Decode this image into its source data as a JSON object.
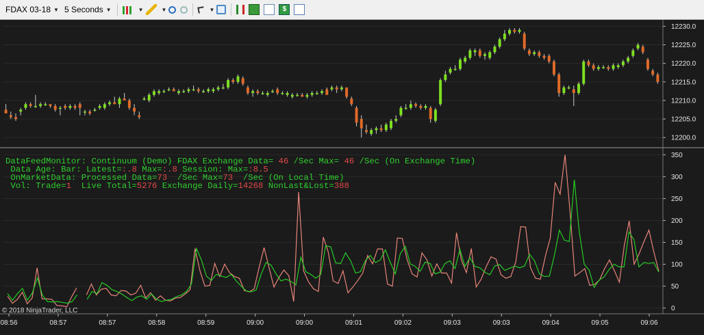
{
  "toolbar": {
    "instrument": "FDAX 03-18",
    "interval": "5 Seconds",
    "icons": [
      "candlestick-chart-icon",
      "pencil-draw-icon",
      "zoom-in-icon",
      "zoom-out-icon",
      "cursor-pointer-icon",
      "crosshair-icon",
      "bar-type-icon",
      "chart-tools-icon",
      "line-chart-icon",
      "dollar-trade-icon",
      "properties-icon"
    ]
  },
  "monitor": {
    "line1": {
      "a": "DataFeedMonitor: Continuum (Demo) FDAX Exchange Data= ",
      "b": "46",
      "c": " /Sec Max= ",
      "d": "46",
      "e": " /Sec (On Exchange Time)"
    },
    "line2": {
      "a": " Data Age: Bar: Latest=",
      "b": ":.8",
      "c": " Max=",
      "d": ":.8",
      "e": " Session: Max=",
      "f": ":8.5"
    },
    "line3": {
      "a": " OnMarketData: Processed Data=",
      "b": "73",
      "c": "  /Sec Max=",
      "d": "73",
      "e": "  /Sec (On Local Time)"
    },
    "line4": {
      "a": " Vol: Trade=",
      "b": "1",
      "c": "  Live Total=",
      "d": "5276",
      "e": " Exchange Daily=",
      "f": "14268",
      "g": " NonLast&Lost=",
      "h": "388"
    }
  },
  "copyright": "© 2018 NinjaTrader, LLC",
  "colors": {
    "up": "#7ee020",
    "down": "#e06a28",
    "green_line": "#26cc26",
    "red_line": "#e8857a",
    "grid": "#2a2a2a"
  },
  "chart_data": [
    {
      "type": "candlestick",
      "ylim": [
        12198,
        12231
      ],
      "yticks": [
        "12200.0",
        "12205.0",
        "12210.0",
        "12215.0",
        "12220.0",
        "12225.0",
        "12230.0"
      ],
      "xticks": [
        "08:56",
        "08:57",
        "08:57",
        "08:58",
        "08:59",
        "09:00",
        "09:00",
        "09:01",
        "09:02",
        "09:03",
        "09:03",
        "09:04",
        "09:05",
        "09:06"
      ],
      "bars": [
        [
          12207.5,
          12209,
          12207,
          12206.5
        ],
        [
          12206,
          12207,
          12205,
          12205.5
        ],
        [
          12205.5,
          12206.5,
          12204.5,
          12205
        ],
        [
          12207,
          12208,
          12206,
          12207.5
        ],
        [
          12208,
          12209.5,
          12207.5,
          12209
        ],
        [
          12209,
          12209.5,
          12208,
          12208.5
        ],
        [
          12208.5,
          12211.5,
          12208,
          12208.5
        ],
        [
          12208.5,
          12209.5,
          12208,
          12209
        ],
        [
          12209,
          12209.5,
          12208.5,
          12209
        ],
        [
          12209,
          12209,
          12208,
          12208.5
        ],
        [
          12208.5,
          12209,
          12207,
          12207.5
        ],
        [
          12208,
          12208.5,
          12206,
          12208
        ],
        [
          12208.5,
          12209,
          12207.5,
          12208
        ],
        [
          12208,
          12209,
          12207.5,
          12208.5
        ],
        [
          12208.5,
          12209,
          12207.5,
          12208
        ],
        [
          12209,
          12209.5,
          12206,
          12208
        ],
        [
          12207,
          12207.5,
          12206,
          12207
        ],
        [
          12207,
          12207.5,
          12206,
          12206.5
        ],
        [
          12207.5,
          12208,
          12207,
          12207.5
        ],
        [
          12208,
          12209,
          12207.5,
          12208.5
        ],
        [
          12208,
          12209.5,
          12207.5,
          12209
        ],
        [
          12209,
          12210,
          12208.5,
          12209.5
        ],
        [
          12209.5,
          12211,
          12209,
          12209
        ],
        [
          12209,
          12211,
          12208,
          12210.5
        ],
        [
          12210.5,
          12212,
          12210,
          12210
        ],
        [
          12210,
          12210.5,
          12207.5,
          12208
        ],
        [
          12208,
          12209,
          12206,
          12207
        ],
        [
          12206,
          12207,
          12205,
          12205.5
        ],
        [
          12210.5,
          12211,
          12210,
          12210.5
        ],
        [
          12210,
          12212,
          12209.5,
          12211.5
        ],
        [
          12211.5,
          12213,
          12211,
          12212.5
        ],
        [
          12212,
          12213,
          12211.5,
          12212.5
        ],
        [
          12212.5,
          12213,
          12212,
          12212.5
        ],
        [
          12213,
          12213.5,
          12212.5,
          12213
        ],
        [
          12213,
          12213.5,
          12212.5,
          12212.5
        ],
        [
          12212,
          12213,
          12211.5,
          12212.5
        ],
        [
          12212.5,
          12213,
          12212,
          12212.5
        ],
        [
          12212.5,
          12213.5,
          12212,
          12213
        ],
        [
          12213,
          12214,
          12212.5,
          12213
        ],
        [
          12213,
          12213.5,
          12212,
          12212.5
        ],
        [
          12212.5,
          12213,
          12212,
          12212.5
        ],
        [
          12212.5,
          12213.5,
          12212,
          12213
        ],
        [
          12212.5,
          12213.5,
          12212,
          12213
        ],
        [
          12213,
          12214,
          12212.5,
          12213.5
        ],
        [
          12213.5,
          12214.5,
          12213,
          12213.5
        ],
        [
          12213.5,
          12216,
          12213,
          12215.5
        ],
        [
          12215.5,
          12216,
          12214.5,
          12215
        ],
        [
          12215,
          12217,
          12214.5,
          12216.5
        ],
        [
          12216,
          12216.5,
          12214,
          12214.5
        ],
        [
          12213.5,
          12214,
          12211.5,
          12212
        ],
        [
          12212,
          12213,
          12211,
          12212.5
        ],
        [
          12212.5,
          12213,
          12211.5,
          12212
        ],
        [
          12212,
          12212.5,
          12211.5,
          12212
        ],
        [
          12211.5,
          12212.5,
          12211,
          12212
        ],
        [
          12212.5,
          12213,
          12212,
          12212.5
        ],
        [
          12213,
          12213.5,
          12211.5,
          12212
        ],
        [
          12212,
          12212.5,
          12211.5,
          12212
        ],
        [
          12211.5,
          12212.5,
          12211,
          12212
        ],
        [
          12211,
          12212,
          12210.5,
          12211.5
        ],
        [
          12211.5,
          12212,
          12211,
          12211.5
        ],
        [
          12211.5,
          12212,
          12211,
          12211
        ],
        [
          12211,
          12212,
          12210.5,
          12211.5
        ],
        [
          12211.5,
          12212.5,
          12211,
          12212
        ],
        [
          12212,
          12212.5,
          12211.5,
          12212
        ],
        [
          12212,
          12213,
          12211.5,
          12212.5
        ],
        [
          12213,
          12213.5,
          12211.5,
          12211.5
        ],
        [
          12213,
          12214,
          12212.5,
          12213.5
        ],
        [
          12213.5,
          12214,
          12212,
          12213
        ],
        [
          12213,
          12214,
          12212.5,
          12213.5
        ],
        [
          12213.5,
          12213.5,
          12210.5,
          12211
        ],
        [
          12210.5,
          12211,
          12208.5,
          12209
        ],
        [
          12208,
          12208.5,
          12203,
          12204
        ],
        [
          12205,
          12206,
          12200,
          12202.5
        ],
        [
          12202,
          12203.5,
          12201,
          12201.5
        ],
        [
          12201,
          12202.5,
          12200.5,
          12202
        ],
        [
          12202,
          12203,
          12201,
          12202.5
        ],
        [
          12202.5,
          12203.5,
          12201.5,
          12202
        ],
        [
          12202,
          12204,
          12201.5,
          12203.5
        ],
        [
          12202.5,
          12205,
          12202,
          12204.5
        ],
        [
          12204.5,
          12206,
          12204,
          12205
        ],
        [
          12206,
          12208.5,
          12205.5,
          12208
        ],
        [
          12208,
          12209,
          12207.5,
          12208
        ],
        [
          12208,
          12210,
          12207.5,
          12209
        ],
        [
          12209,
          12209.5,
          12208,
          12208.5
        ],
        [
          12208.5,
          12209,
          12207.5,
          12208
        ],
        [
          12208,
          12209,
          12207.5,
          12208.5
        ],
        [
          12208,
          12208.5,
          12204,
          12205
        ],
        [
          12204.5,
          12208,
          12204,
          12207.5
        ],
        [
          12209,
          12216,
          12208.5,
          12215.5
        ],
        [
          12215.5,
          12218,
          12215,
          12217
        ],
        [
          12217.5,
          12219,
          12217,
          12218.5
        ],
        [
          12218.5,
          12219.5,
          12218,
          12218.5
        ],
        [
          12218.5,
          12221.5,
          12218,
          12221
        ],
        [
          12220.5,
          12222,
          12220,
          12221.5
        ],
        [
          12221.5,
          12224,
          12221,
          12223.5
        ],
        [
          12223,
          12224,
          12222,
          12223.5
        ],
        [
          12223.5,
          12224,
          12221.5,
          12222
        ],
        [
          12222,
          12223,
          12221,
          12222.5
        ],
        [
          12221.5,
          12223.5,
          12221,
          12223
        ],
        [
          12223,
          12225,
          12222.5,
          12224.5
        ],
        [
          12224.5,
          12227,
          12224,
          12226.5
        ],
        [
          12226.5,
          12229,
          12226,
          12228
        ],
        [
          12228,
          12229.5,
          12227.5,
          12229
        ],
        [
          12229,
          12229.5,
          12228,
          12228.5
        ],
        [
          12228.5,
          12229.5,
          12228,
          12229
        ],
        [
          12228,
          12228.5,
          12223.5,
          12224
        ],
        [
          12223.5,
          12224,
          12222,
          12222.5
        ],
        [
          12222.5,
          12223.5,
          12222,
          12223
        ],
        [
          12223,
          12223.5,
          12221.5,
          12222
        ],
        [
          12222,
          12222.5,
          12221,
          12221.5
        ],
        [
          12222,
          12222.5,
          12220,
          12220.5
        ],
        [
          12220.5,
          12221,
          12216.5,
          12217
        ],
        [
          12217,
          12217.5,
          12211,
          12212
        ],
        [
          12212,
          12214,
          12211.5,
          12213.5
        ],
        [
          12213.5,
          12214,
          12213,
          12213.5
        ],
        [
          12213,
          12214,
          12208.5,
          12212
        ],
        [
          12212,
          12215,
          12211.5,
          12214.5
        ],
        [
          12214.5,
          12221,
          12214,
          12220.5
        ],
        [
          12220.5,
          12221,
          12219,
          12219.5
        ],
        [
          12219.5,
          12220,
          12218,
          12218.5
        ],
        [
          12218.5,
          12219.5,
          12218,
          12219
        ],
        [
          12219,
          12219.5,
          12218.5,
          12219
        ],
        [
          12219,
          12219.5,
          12218,
          12218.5
        ],
        [
          12218.5,
          12220,
          12218,
          12219.5
        ],
        [
          12219,
          12220,
          12218.5,
          12219.5
        ],
        [
          12219.5,
          12221,
          12219,
          12220.5
        ],
        [
          12220.5,
          12222,
          12220,
          12221.5
        ],
        [
          12222,
          12224,
          12221.5,
          12223.5
        ],
        [
          12224,
          12225.5,
          12223.5,
          12225
        ],
        [
          12224.5,
          12225,
          12222.5,
          12223
        ],
        [
          12221,
          12221.5,
          12218,
          12218.5
        ],
        [
          12218,
          12218.5,
          12216.5,
          12217
        ],
        [
          12217,
          12217.5,
          12214.5,
          12215
        ]
      ]
    },
    {
      "type": "line",
      "ylim": [
        -10,
        360
      ],
      "yticks": [
        "0",
        "50",
        "100",
        "150",
        "200",
        "250",
        "300",
        "350"
      ],
      "series": [
        {
          "values": [
            27,
            11,
            20,
            36,
            10,
            23,
            92,
            21,
            21,
            20,
            6,
            5,
            3,
            26,
            46,
            null,
            30,
            55,
            30,
            43,
            45,
            30,
            28,
            40,
            39,
            30,
            34,
            52,
            23,
            35,
            18,
            28,
            18,
            16,
            23,
            24,
            32,
            42,
            136,
            85,
            50,
            52,
            102,
            72,
            100,
            81,
            72,
            68,
            40,
            37,
            44,
            93,
            138,
            93,
            48,
            70,
            87,
            74,
            15,
            265,
            85,
            60,
            44,
            38,
            162,
            128,
            62,
            56,
            85,
            35,
            48,
            63,
            80,
            120,
            101,
            135,
            135,
            55,
            50,
            160,
            159,
            110,
            78,
            71,
            126,
            110,
            73,
            101,
            80,
            80,
            57,
            172,
            109,
            81,
            136,
            48,
            66,
            94,
            117,
            112,
            76,
            68,
            72,
            105,
            186,
            185,
            92,
            68,
            66,
            118,
            160,
            287,
            260,
            350,
            222,
            73,
            81,
            90,
            52,
            54,
            64,
            90,
            110,
            85,
            59,
            143,
            199,
            100,
            124,
            152,
            178,
            128,
            84
          ]
        },
        {
          "values": [
            33,
            18,
            33,
            45,
            18,
            35,
            69,
            30,
            15,
            14,
            15,
            13,
            11,
            15,
            30,
            null,
            20,
            38,
            33,
            58,
            52,
            42,
            38,
            32,
            24,
            17,
            25,
            28,
            20,
            32,
            20,
            15,
            18,
            20,
            26,
            30,
            38,
            55,
            136,
            110,
            73,
            63,
            77,
            73,
            70,
            77,
            62,
            50,
            39,
            37,
            41,
            77,
            104,
            98,
            78,
            62,
            66,
            61,
            53,
            116,
            83,
            77,
            68,
            77,
            142,
            140,
            103,
            102,
            126,
            108,
            80,
            83,
            109,
            120,
            104,
            110,
            133,
            104,
            78,
            124,
            141,
            101,
            95,
            84,
            105,
            102,
            78,
            82,
            102,
            108,
            90,
            134,
            95,
            115,
            95,
            92,
            82,
            76,
            96,
            99,
            86,
            91,
            96,
            92,
            96,
            123,
            108,
            78,
            72,
            73,
            120,
            178,
            155,
            152,
            293,
            175,
            100,
            86,
            47,
            64,
            71,
            88,
            100,
            94,
            94,
            174,
            156,
            94,
            104,
            102,
            104,
            82
          ]
        }
      ]
    }
  ]
}
